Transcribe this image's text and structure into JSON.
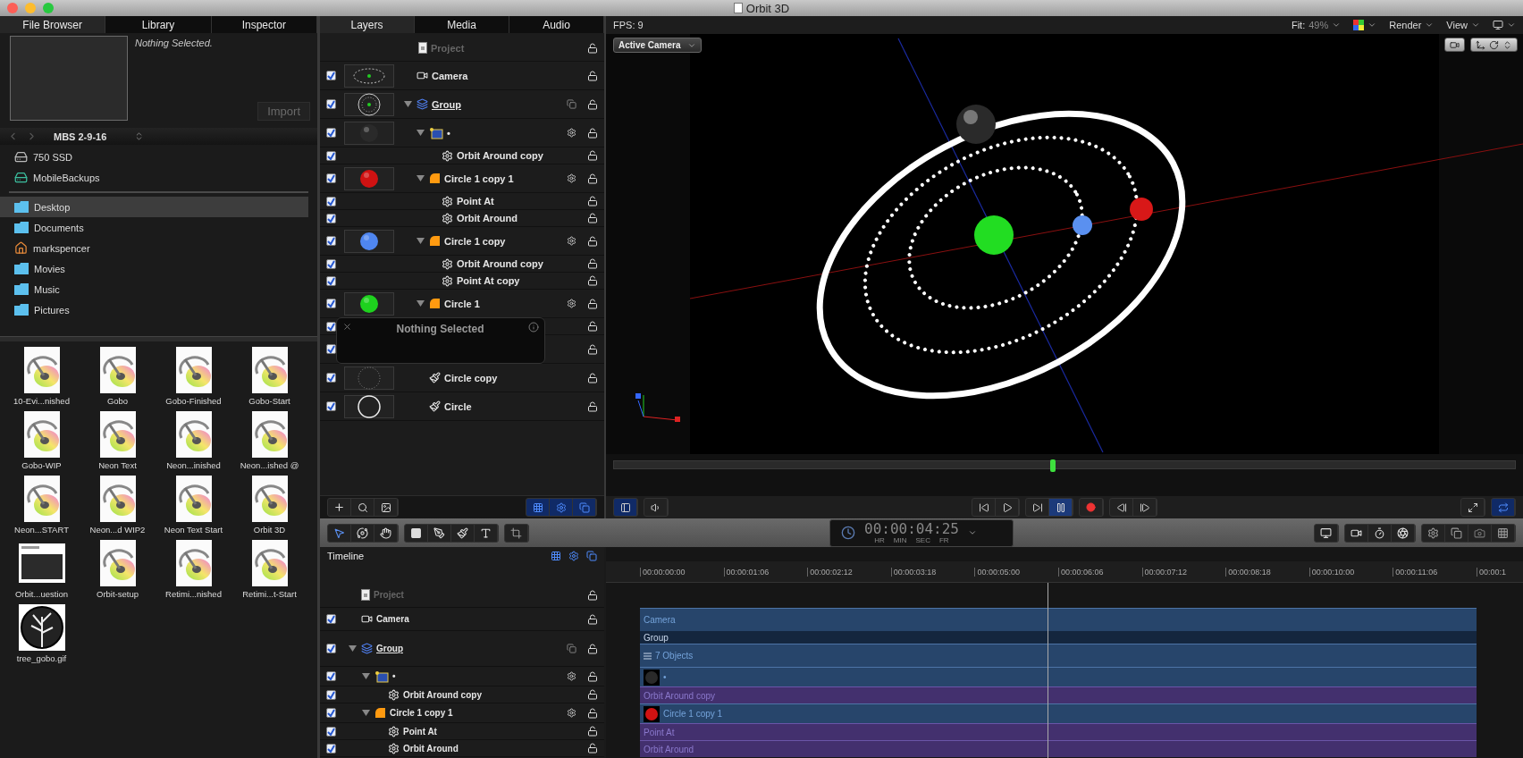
{
  "window": {
    "title": "Orbit 3D"
  },
  "browser": {
    "tabs": [
      {
        "label": "File Browser",
        "selected": true
      },
      {
        "label": "Library",
        "selected": false
      },
      {
        "label": "Inspector",
        "selected": false
      }
    ],
    "preview_caption": "Nothing Selected.",
    "import_button": "Import",
    "location": "MBS 2-9-16",
    "devices": [
      {
        "name": "750 SSD",
        "kind": "drive"
      },
      {
        "name": "MobileBackups",
        "kind": "backup"
      }
    ],
    "places": [
      {
        "name": "Desktop",
        "kind": "folder",
        "selected": true
      },
      {
        "name": "Documents",
        "kind": "folder",
        "selected": false
      },
      {
        "name": "markspencer",
        "kind": "home",
        "selected": false
      },
      {
        "name": "Movies",
        "kind": "folder",
        "selected": false
      },
      {
        "name": "Music",
        "kind": "folder",
        "selected": false
      },
      {
        "name": "Pictures",
        "kind": "folder",
        "selected": false
      }
    ],
    "files": [
      {
        "name": "10-Evi...nished",
        "kind": "motion"
      },
      {
        "name": "Gobo",
        "kind": "motion"
      },
      {
        "name": "Gobo-Finished",
        "kind": "motion"
      },
      {
        "name": "Gobo-Start",
        "kind": "motion"
      },
      {
        "name": "Gobo-WIP",
        "kind": "motion"
      },
      {
        "name": "Neon Text",
        "kind": "motion"
      },
      {
        "name": "Neon...inished",
        "kind": "motion"
      },
      {
        "name": "Neon...ished @",
        "kind": "motion"
      },
      {
        "name": "Neon...START",
        "kind": "motion"
      },
      {
        "name": "Neon...d WIP2",
        "kind": "motion"
      },
      {
        "name": "Neon Text Start",
        "kind": "motion"
      },
      {
        "name": "Orbit 3D",
        "kind": "motion"
      },
      {
        "name": "Orbit...uestion",
        "kind": "screenshot"
      },
      {
        "name": "Orbit-setup",
        "kind": "motion"
      },
      {
        "name": "Retimi...nished",
        "kind": "motion"
      },
      {
        "name": "Retimi...t-Start",
        "kind": "motion"
      },
      {
        "name": "tree_gobo.gif",
        "kind": "image"
      }
    ]
  },
  "layers": {
    "tabs": [
      {
        "label": "Layers",
        "selected": true
      },
      {
        "label": "Media",
        "selected": false
      },
      {
        "label": "Audio",
        "selected": false
      }
    ],
    "rows": [
      {
        "name": "Project",
        "kind": "project"
      },
      {
        "name": "Camera",
        "kind": "camera",
        "checked": true,
        "thumbnail": {
          "kind": "orbit"
        }
      },
      {
        "name": "Group",
        "kind": "group",
        "checked": true,
        "expanded": true,
        "thumbnail": {
          "kind": "rings"
        },
        "children": [
          {
            "name": "•",
            "kind": "text",
            "checked": true,
            "expanded": true,
            "thumbnail": {
              "kind": "sphere"
            },
            "color": "#2a2a2a",
            "children": [
              {
                "name": "Orbit Around copy",
                "kind": "behavior",
                "checked": true
              }
            ]
          },
          {
            "name": "Circle 1 copy 1",
            "kind": "shape",
            "checked": true,
            "expanded": true,
            "thumbnail": {
              "kind": "sphere"
            },
            "color": "#d01212",
            "children": [
              {
                "name": "Point At",
                "kind": "behavior",
                "checked": true
              },
              {
                "name": "Orbit Around",
                "kind": "behavior",
                "checked": true
              }
            ]
          },
          {
            "name": "Circle 1 copy",
            "kind": "shape",
            "checked": true,
            "expanded": true,
            "thumbnail": {
              "kind": "sphere"
            },
            "color": "#4f86f0",
            "children": [
              {
                "name": "Orbit Around copy",
                "kind": "behavior",
                "checked": true
              },
              {
                "name": "Point At copy",
                "kind": "behavior",
                "checked": true
              }
            ]
          },
          {
            "name": "Circle 1",
            "kind": "shape",
            "checked": true,
            "expanded": true,
            "thumbnail": {
              "kind": "sphere"
            },
            "color": "#1ed21e",
            "children": [
              {
                "kind": "behavior",
                "checked": true
              }
            ]
          },
          {
            "kind": "hidden",
            "checked": true
          },
          {
            "name": "Circle copy",
            "kind": "stroke",
            "checked": true,
            "thumbnail": {
              "kind": "dotted-ring"
            }
          },
          {
            "name": "Circle",
            "kind": "stroke",
            "checked": true,
            "thumbnail": {
              "kind": "ring"
            }
          }
        ]
      }
    ],
    "hud": {
      "title": "Nothing Selected"
    }
  },
  "viewer": {
    "fps": "FPS: 9",
    "fit_label": "Fit:",
    "fit_value": "49%",
    "render": "Render",
    "view": "View",
    "camera": "Active Camera",
    "scrubber": {
      "level": 0.487
    }
  },
  "toolbar": {
    "timecode": "00:00:04:25",
    "units": [
      "HR",
      "MIN",
      "SEC",
      "FR"
    ]
  },
  "timeline": {
    "title": "Timeline",
    "ruler": [
      "00:00:00:00",
      "00:00:01:06",
      "00:00:02:12",
      "00:00:03:18",
      "00:00:05:00",
      "00:00:06:06",
      "00:00:07:12",
      "00:00:08:18",
      "00:00:10:00",
      "00:00:11:06",
      "00:00:1"
    ],
    "playhead": {
      "level": 0.487
    },
    "rows": [
      {
        "name": "Project",
        "kind": "project"
      },
      {
        "name": "Camera",
        "kind": "camera",
        "checked": true,
        "track": {
          "label": "Camera"
        }
      },
      {
        "name": "Group",
        "kind": "group",
        "checked": true,
        "expanded": true,
        "track": {
          "label": "Group",
          "sublabel": "7 Objects"
        },
        "children": [
          {
            "name": "•",
            "kind": "text",
            "checked": true,
            "expanded": true,
            "track": {
              "label": "•",
              "color": "#2a2a2a"
            },
            "children": [
              {
                "name": "Orbit Around copy",
                "kind": "behavior",
                "checked": true,
                "track": {
                  "label": "Orbit Around copy"
                }
              }
            ]
          },
          {
            "name": "Circle 1 copy 1",
            "kind": "shape",
            "checked": true,
            "expanded": true,
            "track": {
              "label": "Circle 1 copy 1",
              "color": "#d01212"
            },
            "children": [
              {
                "name": "Point At",
                "kind": "behavior",
                "checked": true,
                "track": {
                  "label": "Point At"
                }
              },
              {
                "name": "Orbit Around",
                "kind": "behavior",
                "checked": true,
                "track": {
                  "label": "Orbit Around"
                }
              }
            ]
          }
        ]
      }
    ]
  }
}
